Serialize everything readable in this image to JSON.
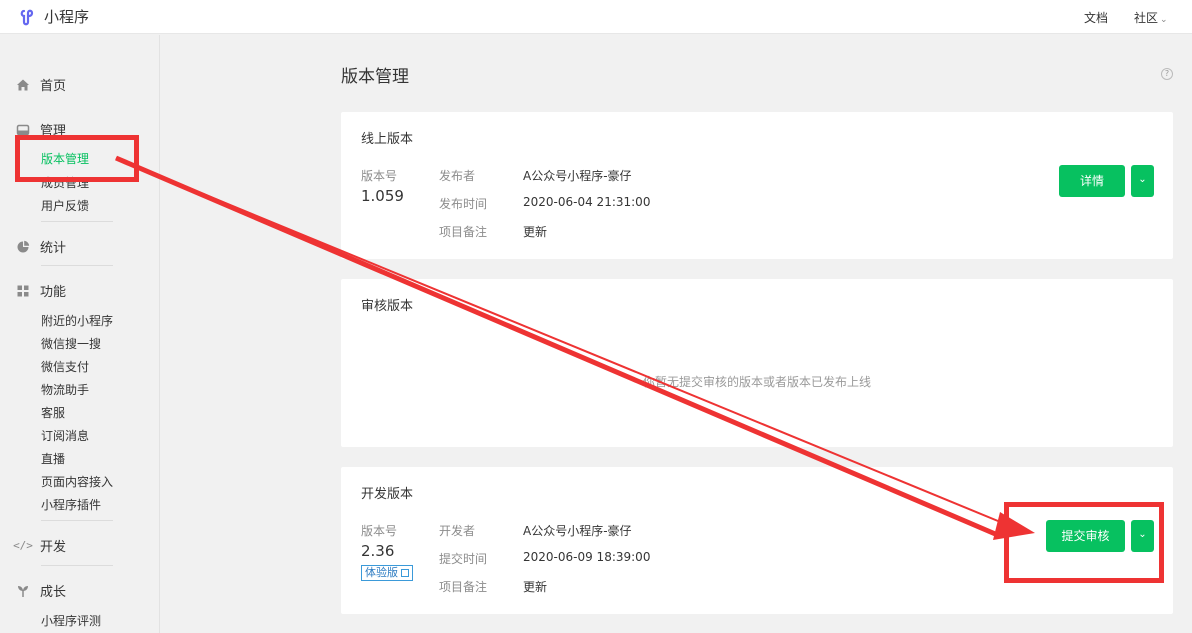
{
  "app": {
    "title": "小程序"
  },
  "topnav": {
    "docs": "文档",
    "community": "社区"
  },
  "sidebar": {
    "home": "首页",
    "manage": {
      "label": "管理",
      "items": [
        "版本管理",
        "成员管理",
        "用户反馈"
      ]
    },
    "stats": "统计",
    "features": {
      "label": "功能",
      "items": [
        "附近的小程序",
        "微信搜一搜",
        "微信支付",
        "物流助手",
        "客服",
        "订阅消息",
        "直播",
        "页面内容接入",
        "小程序插件"
      ]
    },
    "dev": "开发",
    "growth": {
      "label": "成长",
      "items": [
        "小程序评测"
      ]
    }
  },
  "page": {
    "title": "版本管理"
  },
  "online": {
    "title": "线上版本",
    "version_label": "版本号",
    "version": "1.059",
    "publisher_label": "发布者",
    "publisher": "A公众号小程序-豪仔",
    "time_label": "发布时间",
    "time": "2020-06-04 21:31:00",
    "note_label": "项目备注",
    "note": "更新",
    "detail_button": "详情"
  },
  "review": {
    "title": "审核版本",
    "empty": "你暂无提交审核的版本或者版本已发布上线"
  },
  "dev_version": {
    "title": "开发版本",
    "version_label": "版本号",
    "version": "2.36",
    "badge": "体验版",
    "developer_label": "开发者",
    "developer": "A公众号小程序-豪仔",
    "time_label": "提交时间",
    "time": "2020-06-09 18:39:00",
    "note_label": "项目备注",
    "note": "更新",
    "submit_button": "提交审核"
  },
  "colors": {
    "accent": "#07c160",
    "annotation": "#ee3333"
  }
}
